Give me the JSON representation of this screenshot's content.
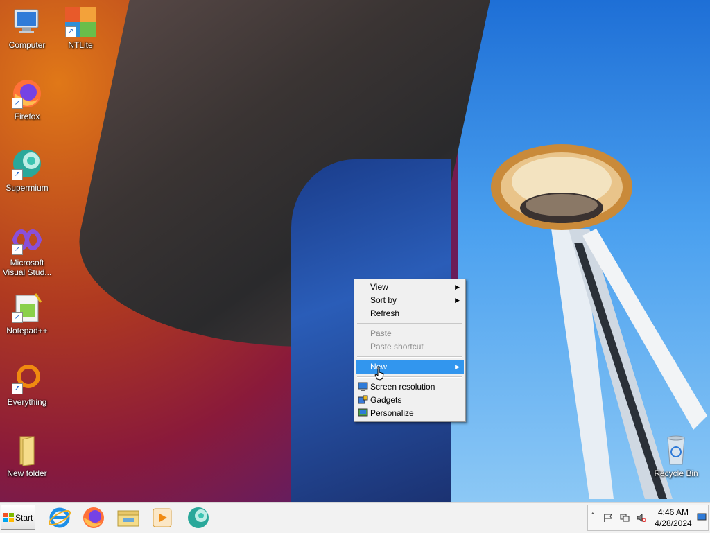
{
  "desktop": {
    "icons": [
      {
        "label": "Computer",
        "icon": "computer-icon"
      },
      {
        "label": "NTLite",
        "icon": "ntlite-icon"
      },
      {
        "label": "Firefox",
        "icon": "firefox-icon"
      },
      {
        "label": "Supermium",
        "icon": "supermium-icon"
      },
      {
        "label": "Microsoft Visual Stud...",
        "icon": "visual-studio-icon"
      },
      {
        "label": "Notepad++",
        "icon": "notepadpp-icon"
      },
      {
        "label": "Everything",
        "icon": "everything-icon"
      },
      {
        "label": "New folder",
        "icon": "folder-icon"
      },
      {
        "label": "Recycle Bin",
        "icon": "recycle-bin-icon"
      }
    ]
  },
  "context_menu": {
    "items": [
      {
        "label": "View",
        "submenu": true
      },
      {
        "label": "Sort by",
        "submenu": true
      },
      {
        "label": "Refresh"
      },
      {
        "label": "Paste",
        "disabled": true
      },
      {
        "label": "Paste shortcut",
        "disabled": true
      },
      {
        "label": "New",
        "submenu": true,
        "highlighted": true
      },
      {
        "label": "Screen resolution",
        "icon": "screen-resolution-icon"
      },
      {
        "label": "Gadgets",
        "icon": "gadgets-icon"
      },
      {
        "label": "Personalize",
        "icon": "personalize-icon"
      }
    ]
  },
  "taskbar": {
    "start_label": "Start",
    "apps": [
      "internet-explorer-icon",
      "firefox-icon",
      "file-explorer-icon",
      "media-player-icon",
      "supermium-icon"
    ],
    "tray": {
      "icons": [
        "show-hidden-icons-chevron",
        "action-center-flag-icon",
        "network-icon",
        "volume-muted-icon"
      ],
      "time": "4:46 AM",
      "date": "4/28/2024"
    }
  },
  "colors": {
    "menu_highlight": "#3296ee",
    "taskbar_bg": "#f2f2f2"
  }
}
